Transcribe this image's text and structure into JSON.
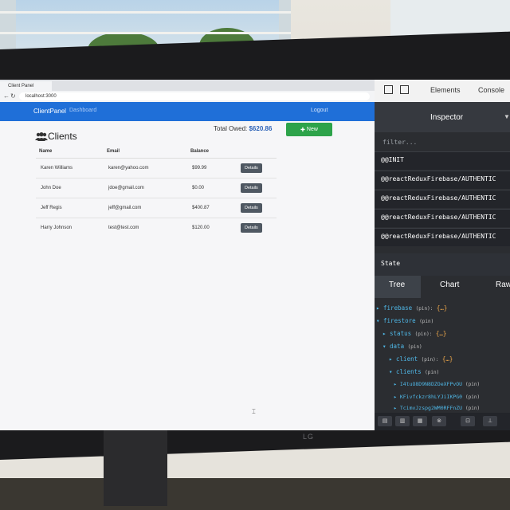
{
  "browser": {
    "tab_title": "Client Panel",
    "url": "localhost:3000"
  },
  "app": {
    "brand": "ClientPanel",
    "nav_dashboard": "Dashboard",
    "nav_logout": "Logout",
    "page_title": "Clients",
    "total_owed_label": "Total Owed:",
    "total_owed_value": "$620.86",
    "new_button": "New",
    "table": {
      "headers": [
        "Name",
        "Email",
        "Balance"
      ],
      "rows": [
        {
          "name": "Karen Williams",
          "email": "karen@yahoo.com",
          "balance": "$99.99",
          "action": "Details"
        },
        {
          "name": "John Doe",
          "email": "jdoe@gmail.com",
          "balance": "$0.00",
          "action": "Details"
        },
        {
          "name": "Jeff Regis",
          "email": "jeff@gmail.com",
          "balance": "$400.87",
          "action": "Details"
        },
        {
          "name": "Harry Johnson",
          "email": "test@test.com",
          "balance": "$120.00",
          "action": "Details"
        }
      ]
    }
  },
  "devtools": {
    "tabs": [
      "Elements",
      "Console"
    ],
    "panel_title": "Inspector",
    "filter_placeholder": "filter...",
    "actions": [
      "@@INIT",
      "@@reactReduxFirebase/AUTHENTIC",
      "@@reactReduxFirebase/AUTHENTIC",
      "@@reactReduxFirebase/AUTHENTIC",
      "@@reactReduxFirebase/AUTHENTIC"
    ],
    "state_label": "State",
    "state_tabs": [
      "Tree",
      "Chart",
      "Raw"
    ],
    "tree": {
      "firebase": "firebase",
      "firestore": "firestore",
      "status": "status",
      "data": "data",
      "client": "client",
      "clients": "clients",
      "ids": [
        "I4tuO8D9N8DZOeXFPvOU",
        "KFivfckzr8hLYJiIKPG0",
        "TcimvJzspg2WM0RFFnZU"
      ],
      "pin": "(pin)",
      "obj": "{…}",
      "colon": ":"
    }
  },
  "monitor": {
    "brand": "LG"
  },
  "colors": {
    "nav_blue": "#1f6fd8",
    "new_green": "#2da34a",
    "owed_blue": "#2f64b8",
    "devtools_bg": "#2b2d31",
    "tree_key": "#4fb7e6",
    "tree_obj": "#f0a94b"
  },
  "icons": [
    "users-icon",
    "plus-icon",
    "inspect-icon",
    "device-toggle-icon",
    "dropdown-arrow-icon",
    "reload-icon"
  ]
}
